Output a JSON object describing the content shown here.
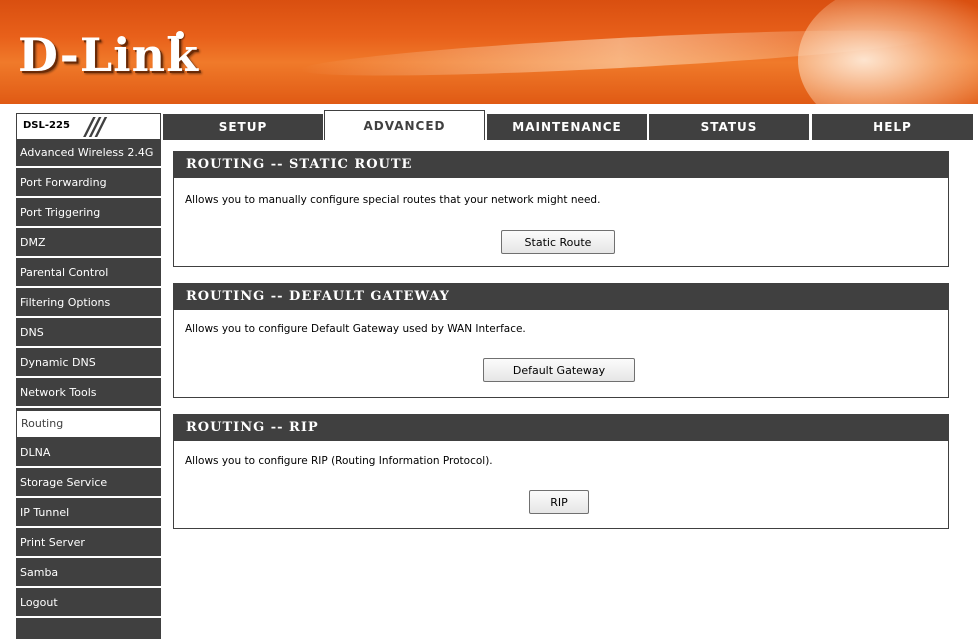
{
  "brand": {
    "logo_text": "D-Link"
  },
  "model": {
    "label": "DSL-225",
    "slash": "///"
  },
  "tabs": [
    {
      "label": "SETUP"
    },
    {
      "label": "ADVANCED"
    },
    {
      "label": "MAINTENANCE"
    },
    {
      "label": "STATUS"
    },
    {
      "label": "HELP"
    }
  ],
  "active_tab": "ADVANCED",
  "sidebar": {
    "items": [
      {
        "label": "Advanced Wireless 2.4G"
      },
      {
        "label": "Port Forwarding"
      },
      {
        "label": "Port Triggering"
      },
      {
        "label": "DMZ"
      },
      {
        "label": "Parental Control"
      },
      {
        "label": "Filtering Options"
      },
      {
        "label": "DNS"
      },
      {
        "label": "Dynamic DNS"
      },
      {
        "label": "Network Tools"
      },
      {
        "label": "Routing"
      },
      {
        "label": "DLNA"
      },
      {
        "label": "Storage Service"
      },
      {
        "label": "IP Tunnel"
      },
      {
        "label": "Print Server"
      },
      {
        "label": "Samba"
      },
      {
        "label": "Logout"
      }
    ],
    "active_item": "Routing"
  },
  "sections": {
    "static_route": {
      "title": "ROUTING -- STATIC ROUTE",
      "description": "Allows you to manually configure special routes that your network might need.",
      "button": "Static Route"
    },
    "default_gateway": {
      "title": "ROUTING -- DEFAULT GATEWAY",
      "description": "Allows you to configure Default Gateway used by WAN Interface.",
      "button": "Default Gateway"
    },
    "rip": {
      "title": "ROUTING -- RIP",
      "description": "Allows you to configure RIP (Routing Information Protocol).",
      "button": "RIP"
    }
  },
  "colors": {
    "banner_orange": "#e8601a",
    "dark_gray": "#404040",
    "white": "#ffffff"
  }
}
